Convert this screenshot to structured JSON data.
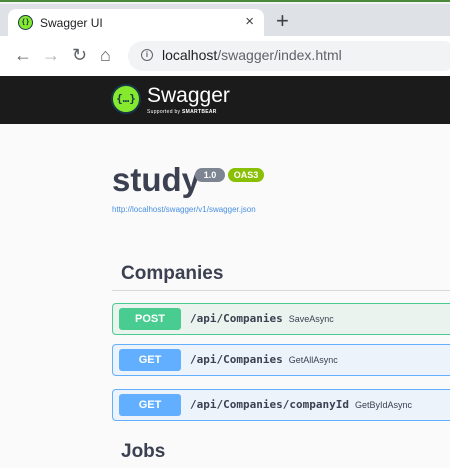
{
  "browser": {
    "tab_title": "Swagger UI",
    "tab_close": "×",
    "new_tab": "+",
    "url_host": "localhost",
    "url_path": "/swagger/index.html"
  },
  "header": {
    "brand": "Swagger",
    "sub_prefix": "Supported by",
    "sub_brand": "SMARTBEAR",
    "logo_glyph": "{…}"
  },
  "info": {
    "title": "study",
    "version": "1.0",
    "oas": "OAS3",
    "spec_url": "http://localhost/swagger/v1/swagger.json"
  },
  "tags": [
    {
      "name": "Companies",
      "operations": [
        {
          "method": "POST",
          "path": "/api/Companies",
          "summary": "SaveAsync"
        },
        {
          "method": "GET",
          "path": "/api/Companies",
          "summary": "GetAllAsync"
        },
        {
          "method": "GET",
          "path": "/api/Companies/companyId",
          "summary": "GetByIdAsync"
        }
      ]
    },
    {
      "name": "Jobs"
    }
  ],
  "colors": {
    "post": "#49cc90",
    "get": "#61affe",
    "header_bg": "#1b1b1b",
    "logo": "#85ea2d"
  }
}
